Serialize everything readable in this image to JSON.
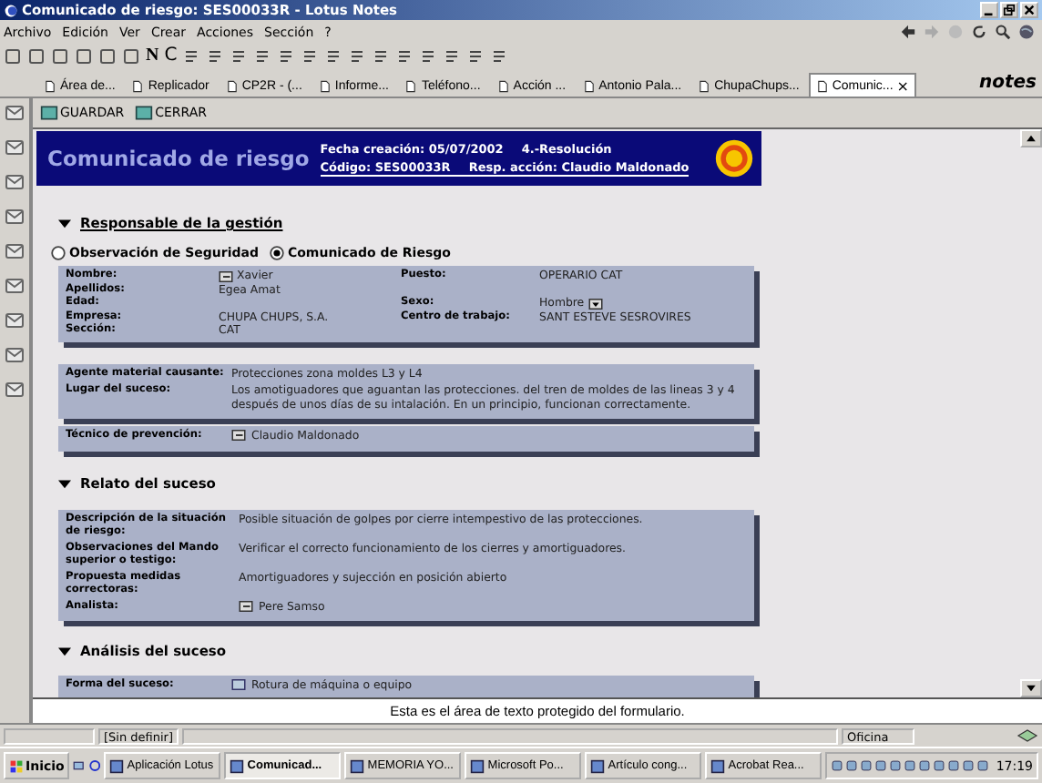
{
  "window": {
    "title": "Comunicado de riesgo: SES00033R - Lotus Notes"
  },
  "menu": [
    "Archivo",
    "Edición",
    "Ver",
    "Crear",
    "Acciones",
    "Sección",
    "?"
  ],
  "toolbar": {
    "text_buttons": [
      "N",
      "C"
    ]
  },
  "tabs": [
    {
      "label": "Área de...",
      "selected": false
    },
    {
      "label": "Replicador",
      "selected": false
    },
    {
      "label": "CP2R - (...",
      "selected": false
    },
    {
      "label": "Informe...",
      "selected": false
    },
    {
      "label": "Teléfono...",
      "selected": false
    },
    {
      "label": "Acción ...",
      "selected": false
    },
    {
      "label": "Antonio Pala...",
      "selected": false
    },
    {
      "label": "ChupaChups...",
      "selected": false
    },
    {
      "label": "Comunic...",
      "selected": true
    }
  ],
  "tab_close": "×",
  "brand": "notes",
  "actions": [
    "GUARDAR",
    "CERRAR"
  ],
  "header": {
    "title": "Comunicado de riesgo",
    "created": "Fecha creación: 05/07/2002",
    "status": "4.-Resolución",
    "code": "Código: SES00033R",
    "responsible": "Resp. acción: Claudio Maldonado"
  },
  "section1": {
    "title": "Responsable de la gestión",
    "expanded": true
  },
  "radios": [
    {
      "label": "Observación de Seguridad",
      "selected": false
    },
    {
      "label": "Comunicado de Riesgo",
      "selected": true
    }
  ],
  "person_panel": [
    {
      "cells": [
        {
          "label": "Nombre:",
          "value": "Xavier",
          "kind": "name"
        },
        {
          "label": "Puesto:",
          "value": "OPERARIO CAT",
          "kind": "text"
        }
      ]
    },
    {
      "cells": [
        {
          "label": "Apellidos:",
          "value": "Egea Amat",
          "kind": "text"
        }
      ]
    },
    {
      "cells": [
        {
          "label": "Edad:",
          "kind": "text"
        },
        {
          "label": "Sexo:",
          "value": "Hombre",
          "kind": "dropdown"
        }
      ]
    },
    {
      "cells": [
        {
          "label": "Empresa:",
          "value": "CHUPA CHUPS, S.A.",
          "kind": "text"
        },
        {
          "label": "Centro de trabajo:",
          "value": "SANT ESTEVE SESROVIRES",
          "kind": "text"
        }
      ]
    },
    {
      "cells": [
        {
          "label": "Sección:",
          "value": "CAT",
          "kind": "text"
        }
      ]
    }
  ],
  "agent_panel": [
    {
      "label": "Agente material causante:",
      "value": "Protecciones zona moldes L3 y L4",
      "kind": "text"
    },
    {
      "label": "Lugar del suceso:",
      "value": "Los amotiguadores que aguantan las protecciones. del tren de moldes de las lineas 3 y 4 después de unos días de su intalación. En un principio, funcionan correctamente.",
      "kind": "text"
    }
  ],
  "technician_panel": [
    {
      "label": "Técnico de prevención:",
      "value": "Claudio Maldonado",
      "kind": "name"
    }
  ],
  "section2": {
    "title": "Relato del suceso",
    "expanded": true
  },
  "story_panel": [
    {
      "label": "Descripción de la situación de riesgo:",
      "value": "Posible situación de golpes por cierre intempestivo de las protecciones.",
      "kind": "text"
    },
    {
      "label": "Observaciones del Mando superior o testigo:",
      "value": "Verificar el correcto funcionamiento de los cierres y amortiguadores.",
      "kind": "text"
    },
    {
      "label": "Propuesta medidas correctoras:",
      "value": "Amortiguadores y sujección en posición abierto",
      "kind": "text"
    },
    {
      "label": "Analista:",
      "value": "Pere Samso",
      "kind": "name"
    }
  ],
  "section3": {
    "title": "Análisis del suceso",
    "expanded": true
  },
  "analysis_panel": [
    {
      "label": "Forma del suceso:",
      "value": "Rotura de máquina o equipo",
      "kind": "keyword"
    }
  ],
  "hint": "Esta es el área de texto protegido del formulario.",
  "status_bar": {
    "field": "[Sin definir]",
    "location": "Oficina"
  },
  "taskbar": {
    "start": "Inicio",
    "items": [
      {
        "label": "Aplicación Lotus",
        "selected": false
      },
      {
        "label": "Comunicad...",
        "selected": true
      },
      {
        "label": "MEMORIA YO...",
        "selected": false
      },
      {
        "label": "Microsoft Po...",
        "selected": false
      },
      {
        "label": "Artículo cong...",
        "selected": false
      },
      {
        "label": "Acrobat Rea...",
        "selected": false
      }
    ],
    "clock": "17:19"
  }
}
